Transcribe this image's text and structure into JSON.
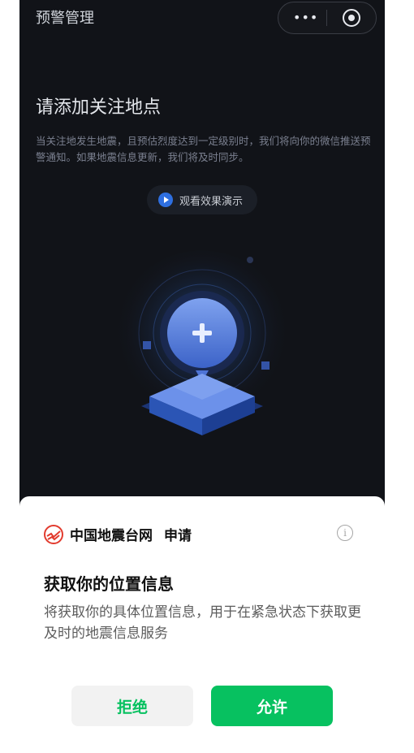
{
  "header": {
    "title": "预警管理"
  },
  "capsule": {
    "more_label": "•••"
  },
  "main": {
    "headline": "请添加关注地点",
    "description": "当关注地发生地震，且预估烈度达到一定级别时，我们将向你的微信推送预警通知。如果地震信息更新，我们将及时同步。",
    "watch_demo_label": "观看效果演示"
  },
  "permission_sheet": {
    "app_name": "中国地震台网",
    "apply_text": "申请",
    "title": "获取你的位置信息",
    "description": "将获取你的具体位置信息，用于在紧急状态下获取更及时的地震信息服务",
    "deny_label": "拒绝",
    "allow_label": "允许",
    "info_icon": "i"
  },
  "colors": {
    "accent_green": "#07c160",
    "dark_bg": "#111318",
    "illustration_blue": "#2e6fe0"
  }
}
